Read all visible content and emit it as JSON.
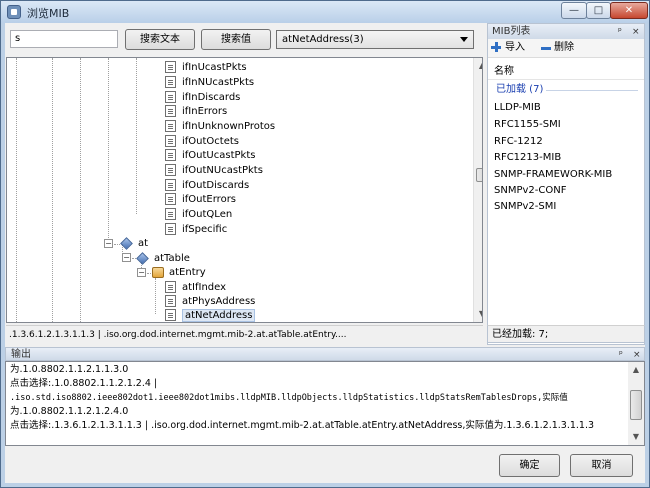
{
  "window": {
    "title": "浏览MIB",
    "minimize": "—",
    "maximize": "□",
    "close": "✕"
  },
  "search": {
    "value": "s",
    "search_text_label": "搜索文本",
    "search_value_label": "搜索值",
    "select_value": "atNetAddress(3)"
  },
  "tree": {
    "items": [
      "ifInUcastPkts",
      "ifInNUcastPkts",
      "ifInDiscards",
      "ifInErrors",
      "ifInUnknownProtos",
      "ifOutOctets",
      "ifOutUcastPkts",
      "ifOutNUcastPkts",
      "ifOutDiscards",
      "ifOutErrors",
      "ifOutQLen",
      "ifSpecific"
    ],
    "at": "at",
    "atTable": "atTable",
    "atEntry": "atEntry",
    "entry_items": [
      "atIfIndex",
      "atPhysAddress",
      "atNetAddress"
    ],
    "expander_minus": "−"
  },
  "tree_status": ".1.3.6.1.2.1.3.1.1.3 | .iso.org.dod.internet.mgmt.mib-2.at.atTable.atEntry....",
  "mib_panel": {
    "title": "MIB列表",
    "pin_glyph": "ᵖ",
    "close_glyph": "×",
    "import_label": "导入",
    "delete_label": "删除",
    "column_header": "名称",
    "group_label": "已加载 (7)",
    "items": [
      "LLDP-MIB",
      "RFC1155-SMI",
      "RFC-1212",
      "RFC1213-MIB",
      "SNMP-FRAMEWORK-MIB",
      "SNMPv2-CONF",
      "SNMPv2-SMI"
    ],
    "status": "已经加载: 7;"
  },
  "output": {
    "title": "输出",
    "lines": [
      "为.1.0.8802.1.1.2.1.1.3.0",
      "点击选择:.1.0.8802.1.1.2.1.2.4 |",
      ".iso.std.iso8802.ieee802dot1.ieee802dot1mibs.lldpMIB.lldpObjects.lldpStatistics.lldpStatsRemTablesDrops,实际值",
      "为.1.0.8802.1.1.2.1.2.4.0",
      "点击选择:.1.3.6.1.2.1.3.1.1.3 | .iso.org.dod.internet.mgmt.mib-2.at.atTable.atEntry.atNetAddress,实际值为.1.3.6.1.2.1.3.1.1.3"
    ]
  },
  "buttons": {
    "ok": "确定",
    "cancel": "取消"
  },
  "scrollbar": {
    "up": "▲",
    "down": "▼"
  }
}
